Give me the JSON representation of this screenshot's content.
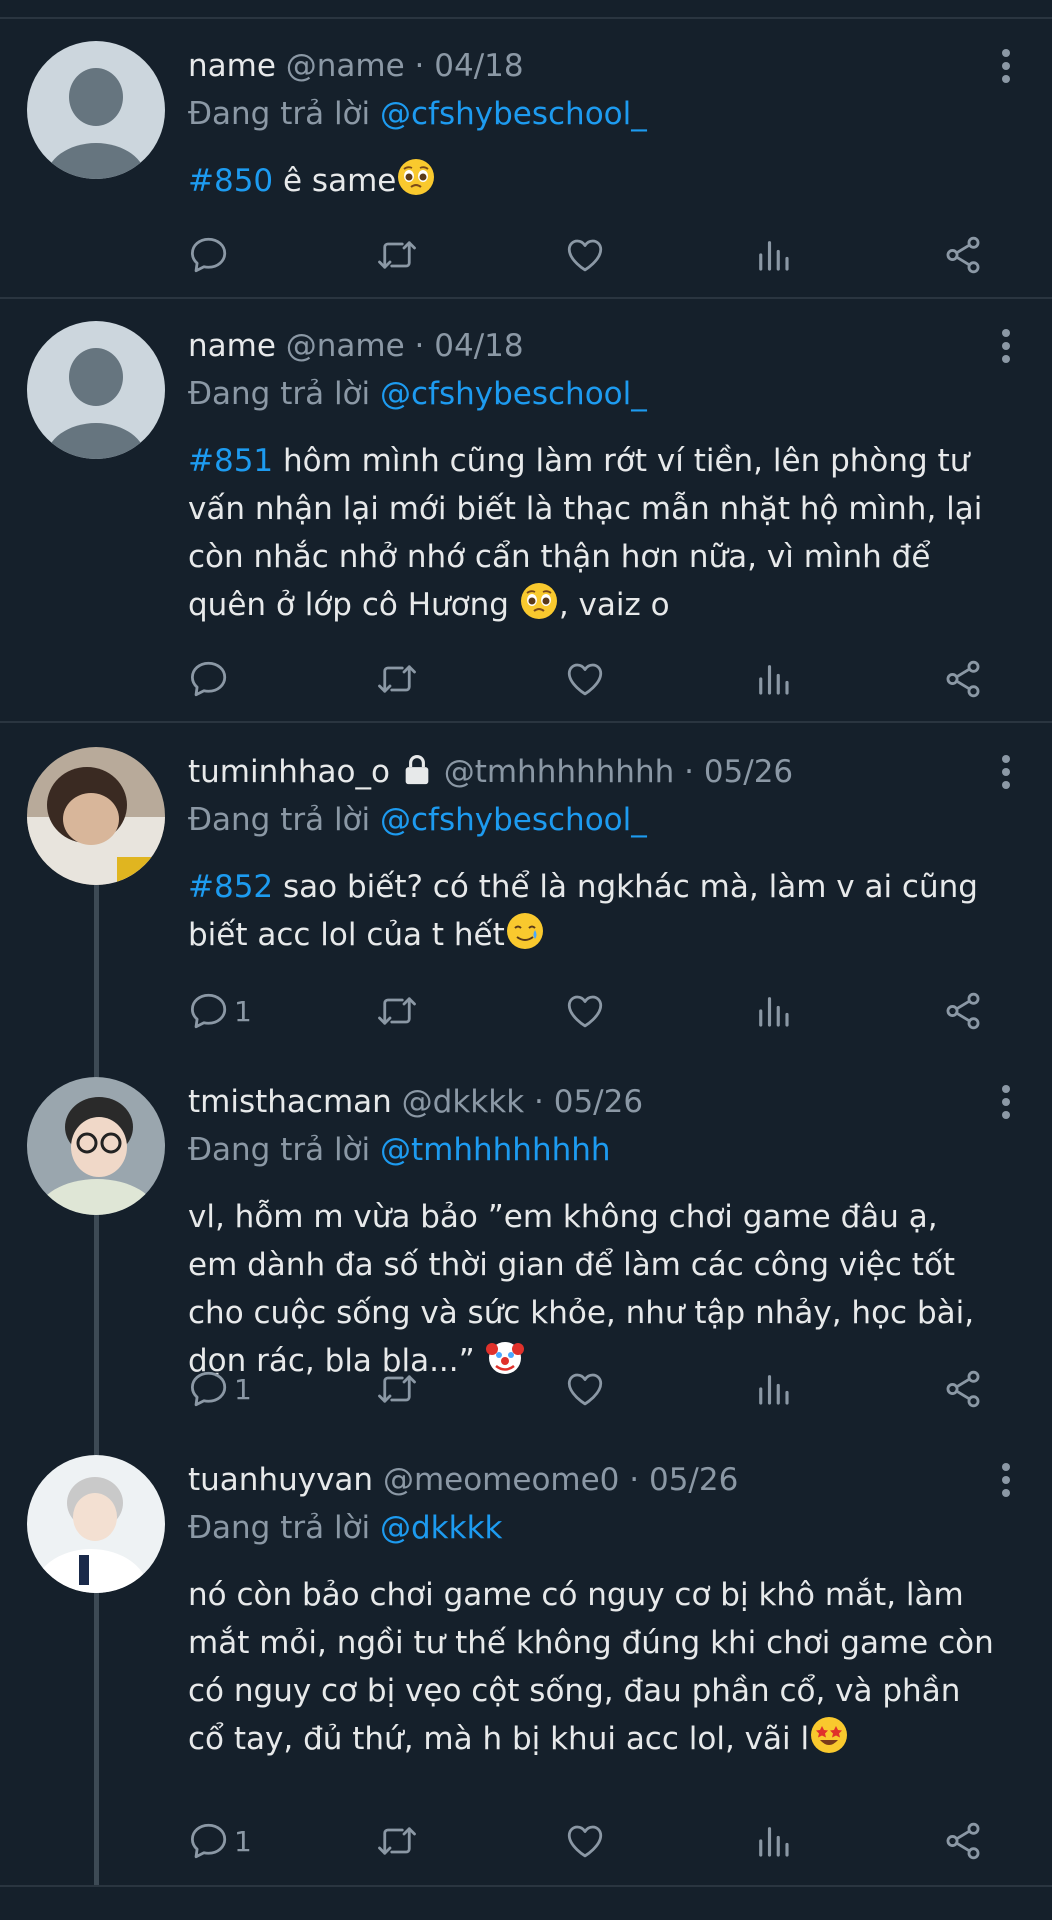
{
  "tweets": [
    {
      "name": "name",
      "handle": "@name",
      "date": "04/18",
      "reply_prefix": "Đang trả lời",
      "reply_to": "@cfshybeschool_",
      "tag": "#850",
      "text": " ê same",
      "emoji": "pleading",
      "reply_count": ""
    },
    {
      "name": "name",
      "handle": "@name",
      "date": "04/18",
      "reply_prefix": "Đang trả lời",
      "reply_to": "@cfshybeschool_",
      "tag": "#851",
      "text": " hôm mình cũng làm rớt ví tiền, lên phòng tư vấn nhận lại mới biết là thạc mẫn nhặt hộ mình, lại còn nhắc nhở nhớ cẩn thận hơn nữa, vì mình để quên ở lớp cô Hương ",
      "text2": ", vaiz o",
      "emoji": "pleading",
      "reply_count": ""
    },
    {
      "name": "tuminhhao_o",
      "handle": "@tmhhhhhhhh",
      "date": "05/26",
      "reply_prefix": "Đang trả lời",
      "reply_to": "@cfshybeschool_",
      "tag": "#852",
      "text": " sao biết? có thể là ngkhác mà, làm v ai cũng biết acc lol của t hết",
      "emoji": "tear-smile",
      "reply_count": "1",
      "locked": true
    },
    {
      "name": "tmisthacman",
      "handle": "@dkkkk",
      "date": "05/26",
      "reply_prefix": "Đang trả lời",
      "reply_to": "@tmhhhhhhhh",
      "text": "vl, hỗm m vừa bảo ”em không chơi game đâu ạ, em dành đa số thời gian để làm các công việc tốt cho cuộc sống và sức khỏe, như tập nhảy, học bài, dọn rác, bla bla...” ",
      "emoji": "clown",
      "reply_count": "1"
    },
    {
      "name": "tuanhuyvan",
      "handle": "@meomeome0",
      "date": "05/26",
      "reply_prefix": "Đang trả lời",
      "reply_to": "@dkkkk",
      "text": "nó còn bảo chơi game có nguy cơ bị khô mắt, làm mắt mỏi, ngồi tư thế không đúng khi chơi game còn có nguy cơ bị vẹo cột sống, đau phần cổ, và phần cổ tay, đủ thứ, mà h bị khui acc lol, vãi l",
      "emoji": "star-struck",
      "reply_count": "1"
    }
  ],
  "colors": {
    "bg": "#15202b",
    "text": "#e7e9ea",
    "muted": "#8b98a5",
    "accent": "#1d9bf0",
    "divider": "#2a3540"
  },
  "icons": [
    "reply-icon",
    "retweet-icon",
    "like-icon",
    "views-icon",
    "share-icon",
    "more-icon",
    "lock-icon"
  ]
}
